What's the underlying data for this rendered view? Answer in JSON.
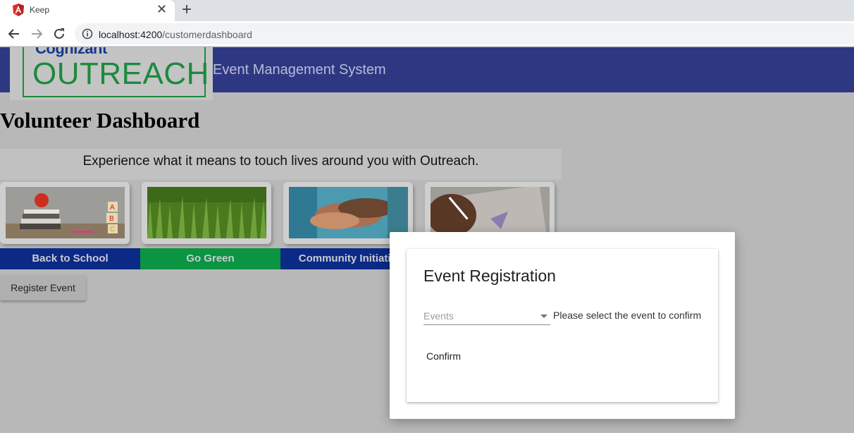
{
  "browser": {
    "tab_title": "Keep",
    "url_host": "localhost:4200",
    "url_path": "/customerdashboard",
    "icons": [
      "angular-favicon-icon",
      "close-icon",
      "plus-icon",
      "back-arrow-icon",
      "forward-arrow-icon",
      "reload-icon",
      "info-icon"
    ]
  },
  "header": {
    "logo_top": "Cognizant",
    "logo_main": "OUTREACH",
    "app_title": "Event Management System",
    "bar_color": "#2e3782"
  },
  "page": {
    "title": "Volunteer Dashboard",
    "banner": "Experience what it means to touch lives around you with Outreach."
  },
  "categories": [
    {
      "label": "Back to School",
      "color": "#0a2a86"
    },
    {
      "label": "Go Green",
      "color": "#0b9441"
    },
    {
      "label": "Community Initiative",
      "color": "#0a2a86"
    },
    {
      "label": "",
      "color": "#0a2a86"
    }
  ],
  "actions": {
    "register_label": "Register Event"
  },
  "dialog": {
    "title": "Event Registration",
    "select_placeholder": "Events",
    "hint": "Please select the event to confirm",
    "confirm_label": "Confirm"
  }
}
